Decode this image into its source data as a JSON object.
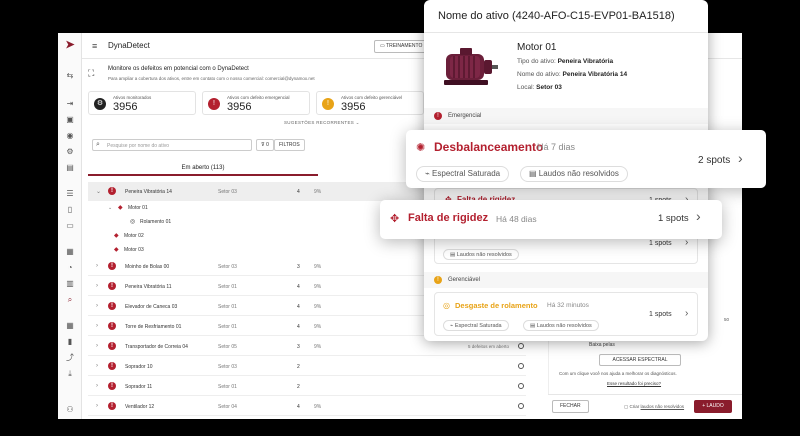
{
  "app": {
    "name": "DynaDetect",
    "training_button": "TREINAMENTO",
    "banner_title": "Monitore os defeitos em potencial com o DynaDetect",
    "banner_sub": "Para ampliar a cobertura dos ativos, entre em contato com o nosso comercial: comercial@dynamox.net",
    "stats": [
      {
        "label": "Ativos monitorados",
        "value": "3956",
        "icon": "gear-icon",
        "color": "#222222"
      },
      {
        "label": "Ativos com defeito emergencial",
        "value": "3956",
        "icon": "alert-circle-icon",
        "color": "#b3202f"
      },
      {
        "label": "Ativos com defeito gerenciável",
        "value": "3956",
        "icon": "warning-triangle-icon",
        "color": "#e8a317"
      }
    ],
    "sugestoes": "SUGESTÕES RECORRENTES",
    "search_placeholder": "Pesquise por nome do ativo",
    "filter_count": "0",
    "filter_label": "FILTROS",
    "tab_open": "Em aberto (113)",
    "rows": [
      {
        "name": "Peneira Vibratória 14",
        "sector": "Setor 03",
        "count": "4",
        "pct": "9%",
        "expanded": true
      },
      {
        "name": "Moinho de Bolas 00",
        "sector": "Setor 03",
        "count": "3",
        "pct": "9%"
      },
      {
        "name": "Peneira Vibratória 11",
        "sector": "Setor 01",
        "count": "4",
        "pct": "9%"
      },
      {
        "name": "Elevador de Caneca 03",
        "sector": "Setor 01",
        "count": "4",
        "pct": "9%"
      },
      {
        "name": "Torre de Resfriamento 01",
        "sector": "Setor 01",
        "count": "4",
        "pct": "9%"
      },
      {
        "name": "Transportador de Correia 04",
        "sector": "Setor 05",
        "count": "3",
        "pct": "9%",
        "defects": "5 defeitos em aberto"
      },
      {
        "name": "Soprador 10",
        "sector": "Setor 03",
        "count": "2",
        "pct": ""
      },
      {
        "name": "Soprador 11",
        "sector": "Setor 01",
        "count": "2",
        "pct": ""
      },
      {
        "name": "Ventilador 12",
        "sector": "Setor 04",
        "count": "4",
        "pct": "9%"
      }
    ],
    "subrows": [
      {
        "label": "Motor 01",
        "child": "Rolamento 01"
      },
      {
        "label": "Motor 02"
      },
      {
        "label": "Motor 03"
      }
    ],
    "right_panel": {
      "baixa": "Baixa pelas",
      "acessar": "ACESSAR ESPECTRAL",
      "curious": "Com um clique você nos ajuda a melhorar os diagnósticos.",
      "esse": "Esse resultado foi preciso?",
      "fifty": "50"
    },
    "bottom": {
      "fechar": "FECHAR",
      "criar_prefix": "Criar",
      "criar_link": "laudos não resolvidos",
      "laudo": "+ LAUDO"
    }
  },
  "modal": {
    "title": "Nome do ativo (4240-AFO-C15-EVP01-BA1518)",
    "asset_name": "Motor 01",
    "tipo_label": "Tipo do ativo:",
    "tipo_value": "Peneira Vibratória",
    "nome_label": "Nome do ativo:",
    "nome_value": "Peneira Vibratória 14",
    "local_label": "Local:",
    "local_value": "Setor 03",
    "section_emergencial": "Emergencial",
    "section_gerenciavel": "Gerenciável",
    "cards": [
      {
        "title": "Falta de rigidez",
        "time": "",
        "spots": "1 spots",
        "chips": []
      },
      {
        "title": "",
        "time": "",
        "spots": "1 spots",
        "chips": [
          "Laudos não resolvidos"
        ]
      },
      {
        "title": "Desgaste de rolamento",
        "time": "Há 32 minutos",
        "spots": "1 spots",
        "chips": [
          "Espectral Saturada",
          "Laudos não resolvidos"
        ]
      }
    ]
  },
  "floats": [
    {
      "title": "Desbalanceamento",
      "time": "Há 7 dias",
      "spots": "2 spots",
      "chips": [
        "Espectral Saturada",
        "Laudos não resolvidos"
      ]
    },
    {
      "title": "Falta de rigidez",
      "time": "Há 48 dias",
      "spots": "1 spots"
    }
  ]
}
